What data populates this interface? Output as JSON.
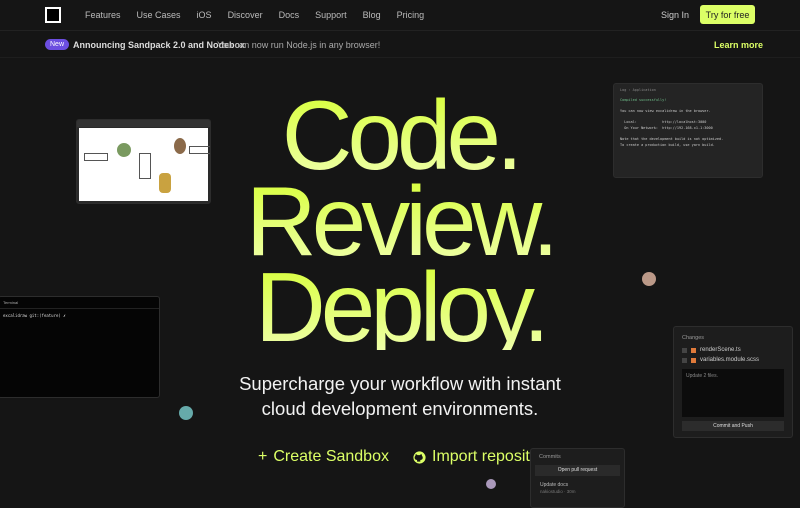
{
  "nav": {
    "links": [
      "Features",
      "Use Cases",
      "iOS",
      "Discover",
      "Docs",
      "Support",
      "Blog",
      "Pricing"
    ],
    "sign_in": "Sign In",
    "try_free": "Try for free"
  },
  "announcement": {
    "badge": "New",
    "title": "Announcing Sandpack 2.0 and Nodebox",
    "subtitle": "You can now run Node.js in any browser!",
    "learn_more": "Learn more"
  },
  "hero": {
    "lines": [
      "Code.",
      "Review.",
      "Deploy."
    ],
    "subtitle_1": "Supercharge your workflow with instant",
    "subtitle_2": "cloud development environments."
  },
  "cta": {
    "create": "Create Sandbox",
    "import": "Import repository"
  },
  "log_panel": {
    "title": "Log › Application",
    "lines": [
      "Compiled successfully!",
      "",
      "You can now view excalidraw in the browser.",
      "",
      "  Local:            http://localhost:3000",
      "  On Your Network:  http://192.168.x1.1:3000",
      "",
      "Note that the development build is not optimized.",
      "To create a production build, use yarn build."
    ]
  },
  "terminal": {
    "title": "Terminal",
    "prompt": "excalidraw git:(feature) ✗"
  },
  "changes": {
    "title": "Changes",
    "files": [
      "renderScene.ts",
      "variables.module.scss"
    ],
    "message": "Update 2 files.",
    "commit": "Commit and Push"
  },
  "commits": {
    "title": "Commits",
    "open_pr": "Open pull request",
    "item": "Update docs",
    "author": "nakiostudio · 30m"
  },
  "colors": {
    "accent": "#dcff66",
    "badge": "#6c4ee0",
    "background": "#151515"
  }
}
